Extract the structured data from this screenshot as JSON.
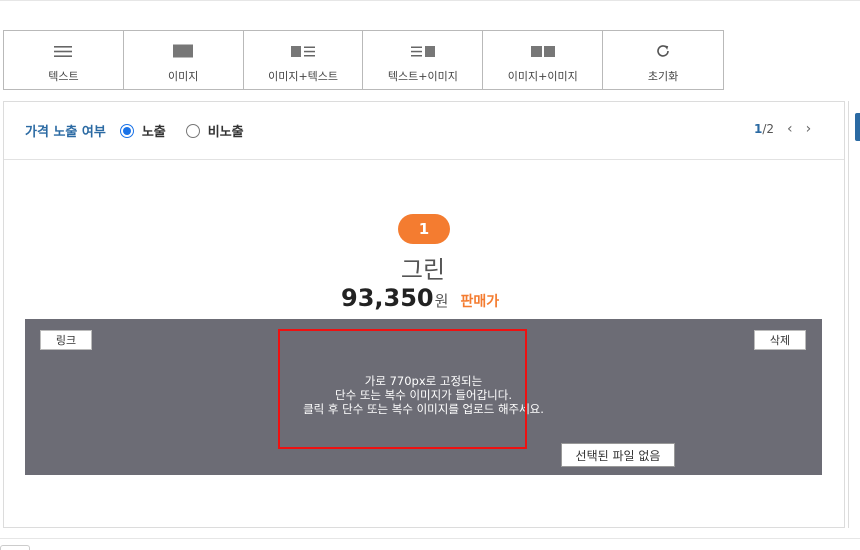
{
  "toolbar": {
    "items": [
      {
        "label": "텍스트",
        "icon": "text-lines-icon"
      },
      {
        "label": "이미지",
        "icon": "image-block-icon"
      },
      {
        "label": "이미지+텍스트",
        "icon": "image-text-icon"
      },
      {
        "label": "텍스트+이미지",
        "icon": "text-image-icon"
      },
      {
        "label": "이미지+이미지",
        "icon": "image-image-icon"
      },
      {
        "label": "초기화",
        "icon": "reset-icon"
      }
    ]
  },
  "panel": {
    "price_visibility_label": "가격 노출 여부",
    "options": [
      {
        "label": "노출",
        "selected": true
      },
      {
        "label": "비노출",
        "selected": false
      }
    ],
    "pager": {
      "current": "1",
      "total": "/2"
    }
  },
  "item": {
    "number": "1",
    "name": "그린",
    "price": "93,350",
    "currency": "원",
    "price_type": "판매가"
  },
  "image_area": {
    "link_label": "링크",
    "delete_label": "삭제",
    "guide_lines": [
      "가로 770px로 고정되는",
      "단수 또는 복수 이미지가 들어갑니다.",
      "클릭 후 단수 또는 복수 이미지를 업로드 해주세요."
    ],
    "file_status": "선택된 파일 없음"
  },
  "colors": {
    "accent_blue": "#2b6aa3",
    "radio_blue": "#1a73e8",
    "orange": "#f47c30",
    "image_bg": "#6c6c75",
    "highlight_red": "#e11111"
  }
}
